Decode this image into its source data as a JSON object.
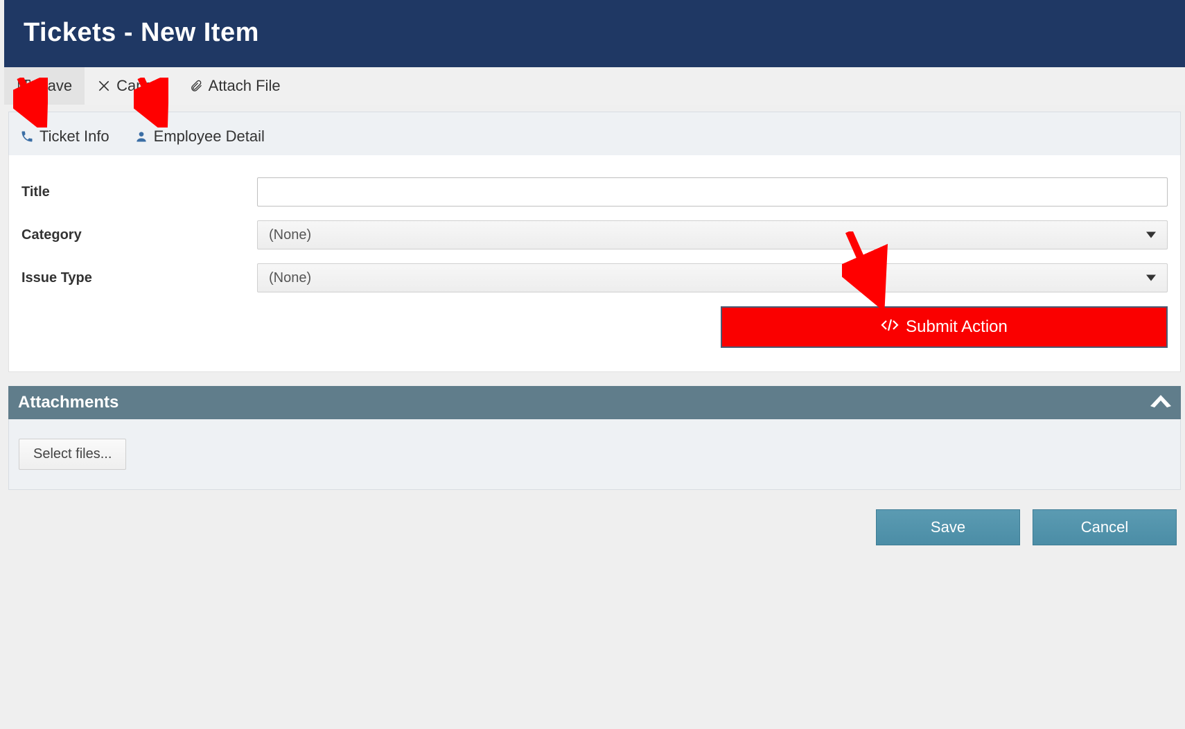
{
  "header": {
    "title": "Tickets - New Item"
  },
  "toolbar": {
    "save_label": "Save",
    "cancel_label": "Cancel",
    "attach_label": "Attach File"
  },
  "tabs": {
    "ticket_info": "Ticket Info",
    "employee_detail": "Employee Detail"
  },
  "form": {
    "title_label": "Title",
    "title_value": "",
    "category_label": "Category",
    "category_value": "(None)",
    "issue_type_label": "Issue Type",
    "issue_type_value": "(None)",
    "submit_action_label": "Submit Action"
  },
  "attachments": {
    "section_title": "Attachments",
    "select_files_label": "Select files..."
  },
  "footer": {
    "save_label": "Save",
    "cancel_label": "Cancel"
  },
  "colors": {
    "header_bg": "#1f3864",
    "submit_bg": "#fa0000",
    "accent_bg": "#607d8b",
    "action_bg": "#4f90a8"
  }
}
